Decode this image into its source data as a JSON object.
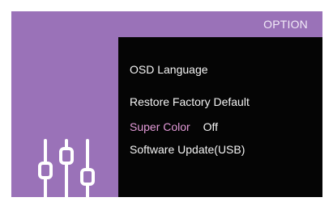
{
  "header": {
    "title": "OPTION"
  },
  "sidebar": {
    "icon": "sliders-icon"
  },
  "colors": {
    "purple": "#9a72b8",
    "panel": "#050505",
    "selected": "#e39ad8"
  },
  "menu": {
    "items": [
      {
        "label": "OSD Language",
        "value": ""
      },
      {
        "label": "Restore Factory Default",
        "value": ""
      },
      {
        "label": "Super Color",
        "value": "Off"
      },
      {
        "label": "Software Update(USB)",
        "value": ""
      }
    ]
  }
}
